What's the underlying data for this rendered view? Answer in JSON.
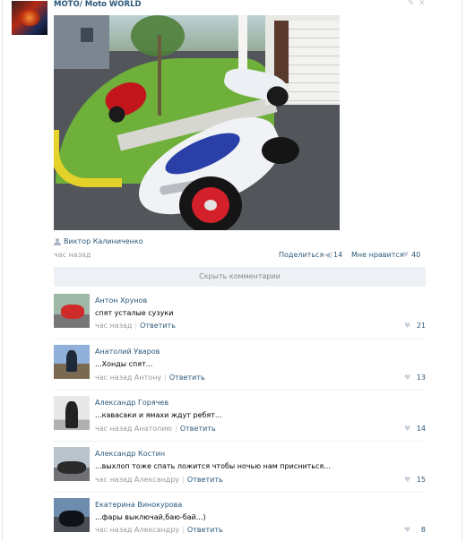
{
  "post": {
    "group_title": "МОТО/ Moto WORLD",
    "author": "Виктор Калиниченко",
    "time": "час назад",
    "share_label": "Поделиться",
    "share_count": "14",
    "like_label": "Мне нравится",
    "like_count": "40",
    "hide_comments_label": "Скрыть комментарии"
  },
  "icons": {
    "edit": "pencil-icon",
    "close": "close-icon",
    "author": "user-icon",
    "share": "megaphone-icon",
    "like": "heart-icon"
  },
  "colors": {
    "link": "#2b587a",
    "muted": "#999999",
    "bar_bg": "#edf1f5"
  },
  "comments": [
    {
      "name": "Антон Хрунов",
      "text": "спят усталые сузуки",
      "time": "час назад",
      "reply": "Ответить",
      "likes": "21"
    },
    {
      "name": "Анатолий Уваров",
      "text": "...Хонды спят...",
      "time": "час назад Антону",
      "reply": "Ответить",
      "likes": "13"
    },
    {
      "name": "Александр Горячев",
      "text": "...кавасаки и ямахи ждут ребят...",
      "time": "час назад Анатолию",
      "reply": "Ответить",
      "likes": "14"
    },
    {
      "name": "Александр Костин",
      "text": "...выхлоп тоже спать ложится чтобы ночью нам присниться...",
      "time": "час назад Александру",
      "reply": "Ответить",
      "likes": "15"
    },
    {
      "name": "Екатерина Винокурова",
      "text": "...фары выключай,баю-бай...)",
      "time": "час назад Александру",
      "reply": "Ответить",
      "likes": "8"
    }
  ]
}
